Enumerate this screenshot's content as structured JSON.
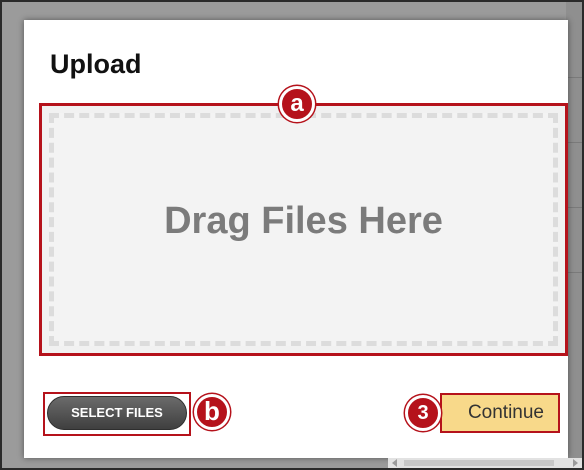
{
  "dialog": {
    "title": "Upload",
    "drop_zone_text": "Drag Files Here",
    "select_files_label": "SELECT FILES",
    "continue_label": "Continue"
  },
  "callouts": {
    "a": "a",
    "b": "b",
    "three": "3"
  },
  "colors": {
    "callout_red": "#b5121b",
    "continue_bg": "#f8d98a",
    "select_button_bg": "#4f4f4f",
    "drop_text": "#7b7b7b"
  }
}
